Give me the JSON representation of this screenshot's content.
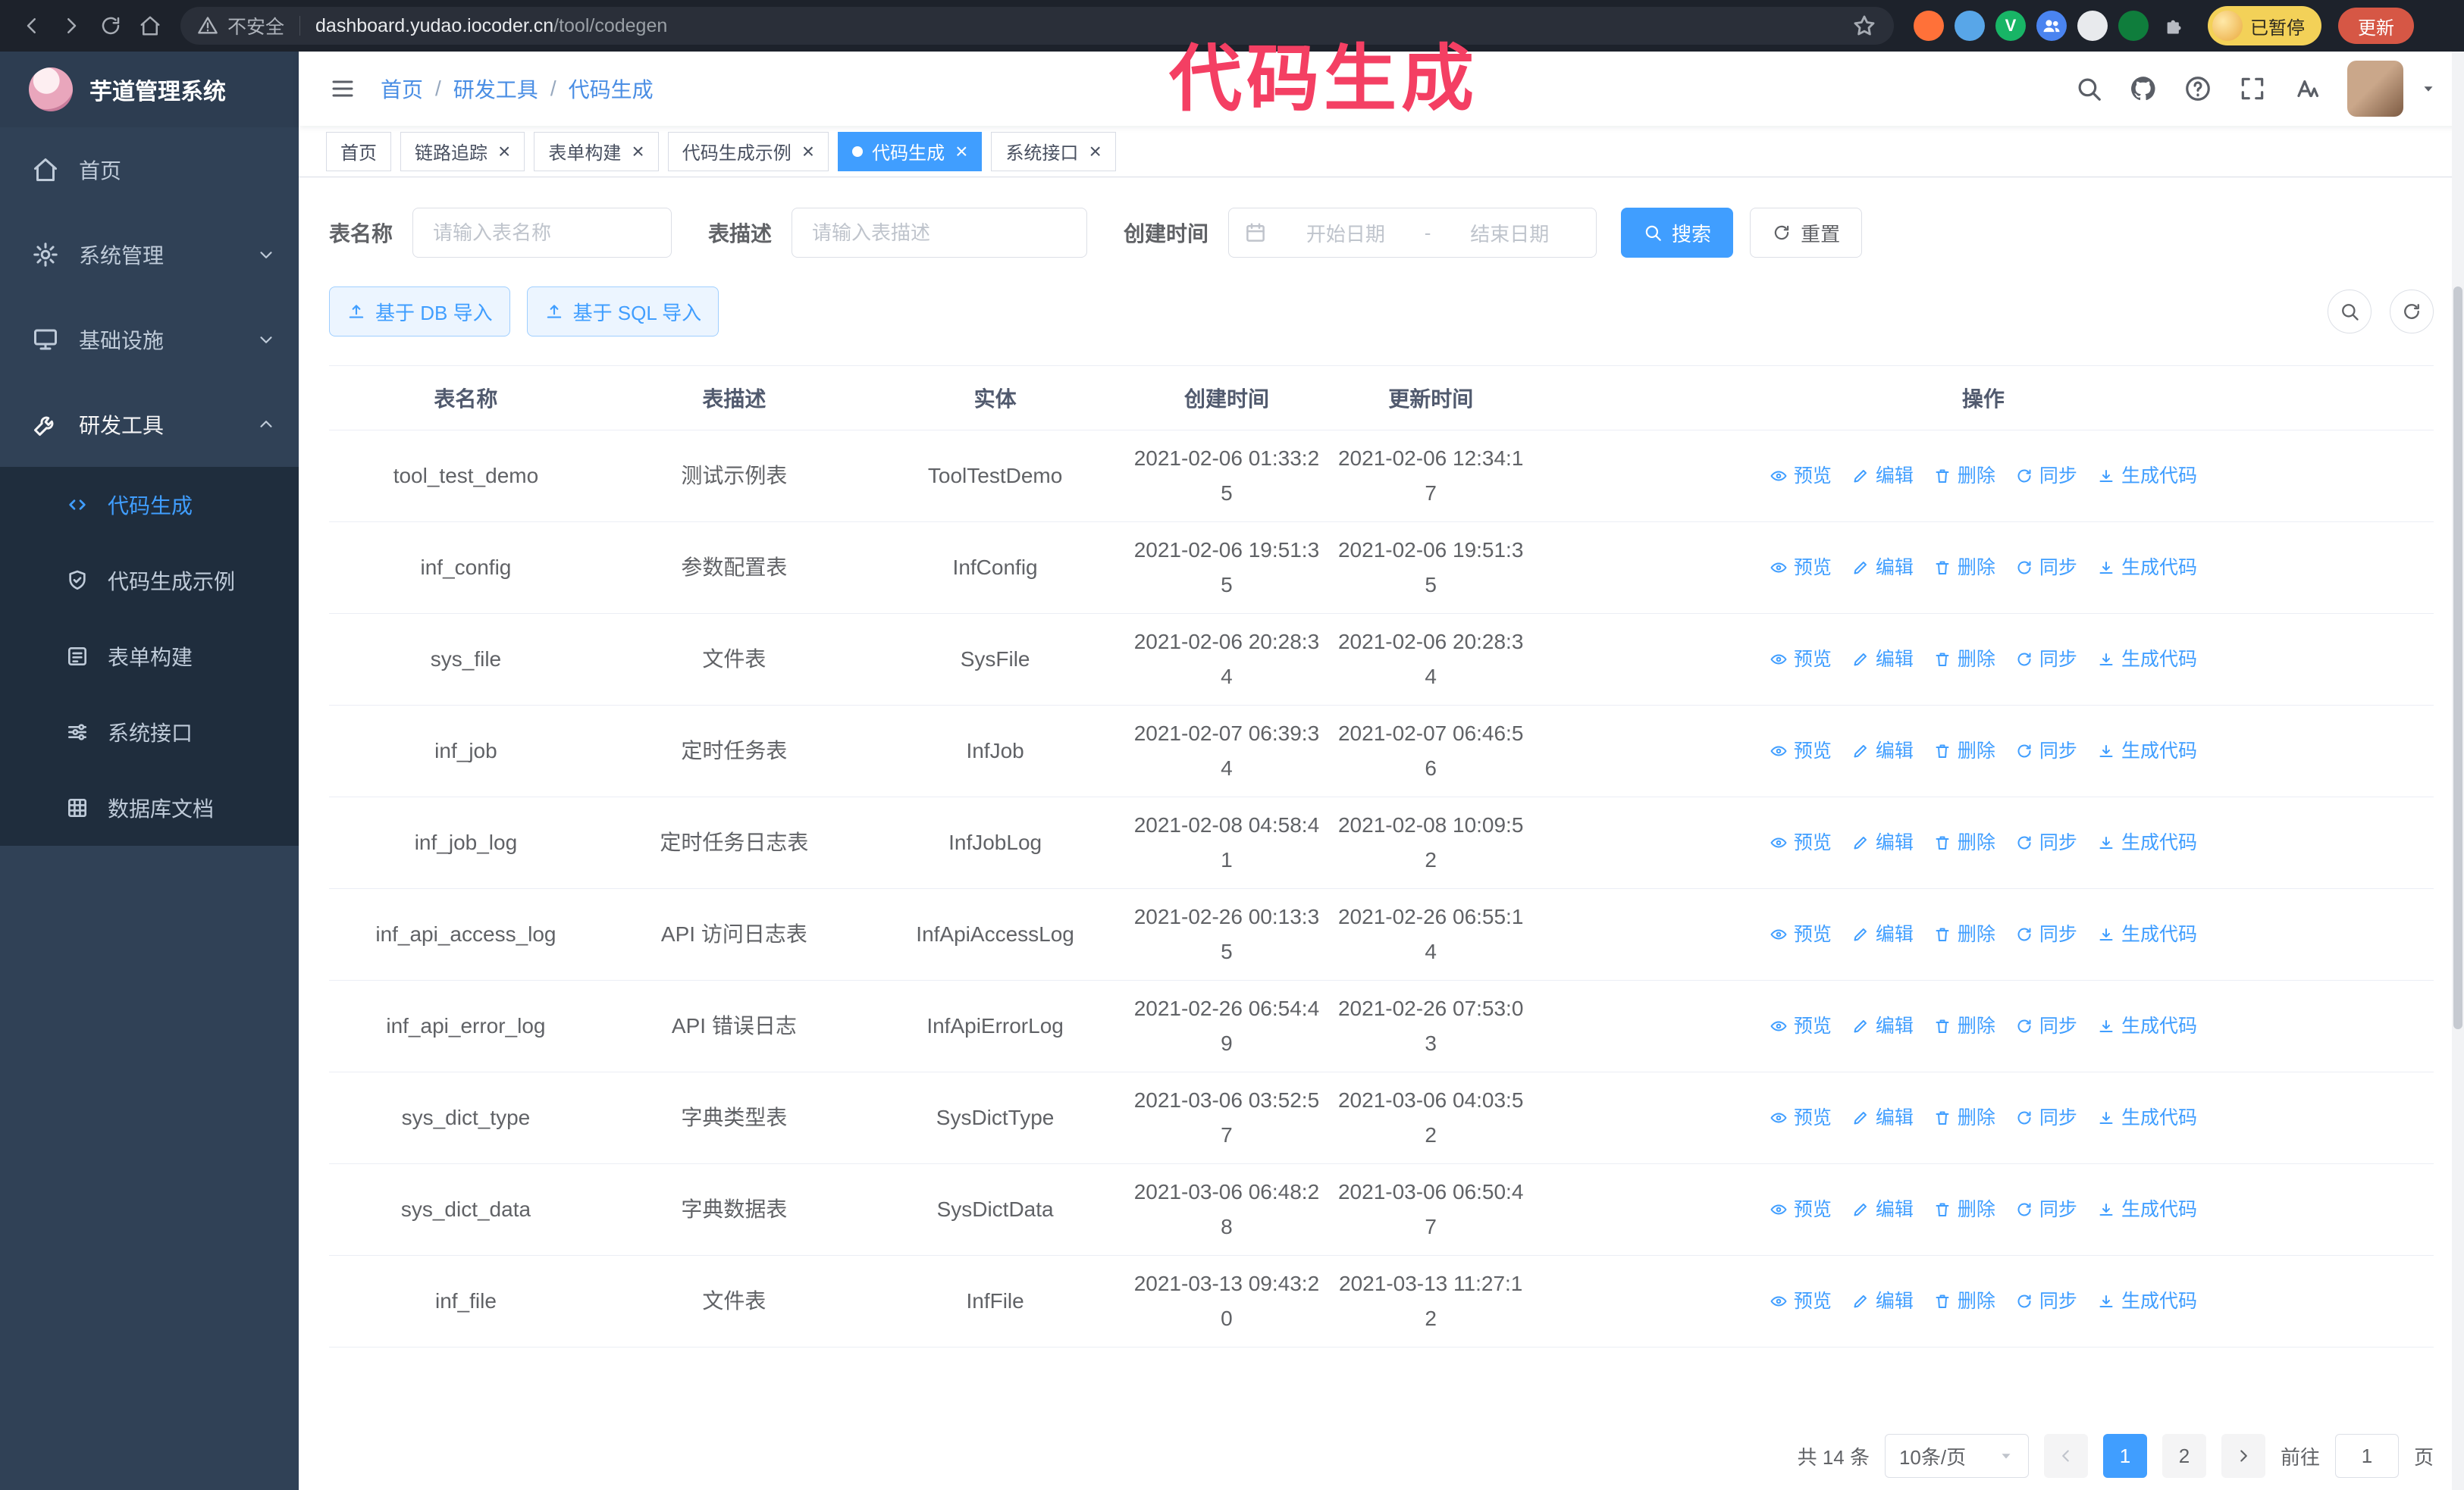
{
  "browser": {
    "security_label": "不安全",
    "url_host": "dashboard.yudao.iocoder.cn",
    "url_path": "/tool/codegen",
    "paused_label": "已暂停",
    "update_label": "更新",
    "extensions": [
      {
        "name": "extension-icon-orange",
        "color": "#ff7139",
        "glyph": ""
      },
      {
        "name": "extension-icon-blue-drop",
        "color": "#58a6e8",
        "glyph": ""
      },
      {
        "name": "extension-icon-green-check",
        "color": "#18b566",
        "glyph": "V"
      },
      {
        "name": "extension-icon-people",
        "color": "#4a84f0",
        "icon": "people-icon"
      },
      {
        "name": "extension-icon-light-tile",
        "color": "#e8eaed",
        "glyph": ""
      },
      {
        "name": "extension-icon-plant",
        "color": "#0f7d3c",
        "glyph": ""
      },
      {
        "name": "extensions-puzzle-icon",
        "color": "",
        "icon": "puzzle-icon"
      }
    ]
  },
  "annotation": "代码生成",
  "colors": {
    "accent": "#409eff",
    "sidebar_bg": "#304156",
    "submenu_bg": "#1f2d3d",
    "annotation": "#f43f63",
    "active_tab_bg": "#409eff"
  },
  "sidebar": {
    "title": "芋道管理系统",
    "menu": [
      {
        "id": "home",
        "label": "首页",
        "icon": "home-icon"
      },
      {
        "id": "system",
        "label": "系统管理",
        "icon": "gear-icon",
        "chevron": "down"
      },
      {
        "id": "infra",
        "label": "基础设施",
        "icon": "monitor-icon",
        "chevron": "down"
      },
      {
        "id": "devtools",
        "label": "研发工具",
        "icon": "tools-icon",
        "chevron": "up",
        "expanded": true,
        "children": [
          {
            "id": "codegen",
            "label": "代码生成",
            "icon": "code-icon",
            "active": true
          },
          {
            "id": "codegen-example",
            "label": "代码生成示例",
            "icon": "shield-icon"
          },
          {
            "id": "form-builder",
            "label": "表单构建",
            "icon": "form-icon"
          },
          {
            "id": "system-api",
            "label": "系统接口",
            "icon": "sliders-icon"
          },
          {
            "id": "db-doc",
            "label": "数据库文档",
            "icon": "grid-icon"
          }
        ]
      }
    ]
  },
  "header": {
    "breadcrumb": [
      "首页",
      "研发工具",
      "代码生成"
    ]
  },
  "tabs": [
    {
      "id": "home",
      "label": "首页",
      "closable": false,
      "active": false
    },
    {
      "id": "tracer",
      "label": "链路追踪",
      "closable": true,
      "active": false
    },
    {
      "id": "form-builder",
      "label": "表单构建",
      "closable": true,
      "active": false
    },
    {
      "id": "codegen-example",
      "label": "代码生成示例",
      "closable": true,
      "active": false
    },
    {
      "id": "codegen",
      "label": "代码生成",
      "closable": true,
      "active": true
    },
    {
      "id": "system-api",
      "label": "系统接口",
      "closable": true,
      "active": false
    }
  ],
  "filters": {
    "name_label": "表名称",
    "name_placeholder": "请输入表名称",
    "desc_label": "表描述",
    "desc_placeholder": "请输入表描述",
    "time_label": "创建时间",
    "start_placeholder": "开始日期",
    "range_separator": "-",
    "end_placeholder": "结束日期",
    "search_label": "搜索",
    "reset_label": "重置"
  },
  "toolbar": {
    "import_db_label": "基于 DB 导入",
    "import_sql_label": "基于 SQL 导入"
  },
  "table": {
    "columns": [
      "表名称",
      "表描述",
      "实体",
      "创建时间",
      "更新时间",
      "操作"
    ],
    "actions": [
      {
        "name": "preview-link",
        "label": "预览",
        "icon": "eye-icon"
      },
      {
        "name": "edit-link",
        "label": "编辑",
        "icon": "edit-icon"
      },
      {
        "name": "delete-link",
        "label": "删除",
        "icon": "delete-icon"
      },
      {
        "name": "sync-link",
        "label": "同步",
        "icon": "sync-icon"
      },
      {
        "name": "generate-code-link",
        "label": "生成代码",
        "icon": "download-icon"
      }
    ],
    "rows": [
      {
        "name": "tool_test_demo",
        "desc": "测试示例表",
        "entity": "ToolTestDemo",
        "created": "2021-02-06 01:33:25",
        "updated": "2021-02-06 12:34:17"
      },
      {
        "name": "inf_config",
        "desc": "参数配置表",
        "entity": "InfConfig",
        "created": "2021-02-06 19:51:35",
        "updated": "2021-02-06 19:51:35"
      },
      {
        "name": "sys_file",
        "desc": "文件表",
        "entity": "SysFile",
        "created": "2021-02-06 20:28:34",
        "updated": "2021-02-06 20:28:34"
      },
      {
        "name": "inf_job",
        "desc": "定时任务表",
        "entity": "InfJob",
        "created": "2021-02-07 06:39:34",
        "updated": "2021-02-07 06:46:56"
      },
      {
        "name": "inf_job_log",
        "desc": "定时任务日志表",
        "entity": "InfJobLog",
        "created": "2021-02-08 04:58:41",
        "updated": "2021-02-08 10:09:52"
      },
      {
        "name": "inf_api_access_log",
        "desc": "API 访问日志表",
        "entity": "InfApiAccessLog",
        "created": "2021-02-26 00:13:35",
        "updated": "2021-02-26 06:55:14"
      },
      {
        "name": "inf_api_error_log",
        "desc": "API 错误日志",
        "entity": "InfApiErrorLog",
        "created": "2021-02-26 06:54:49",
        "updated": "2021-02-26 07:53:03"
      },
      {
        "name": "sys_dict_type",
        "desc": "字典类型表",
        "entity": "SysDictType",
        "created": "2021-03-06 03:52:57",
        "updated": "2021-03-06 04:03:52"
      },
      {
        "name": "sys_dict_data",
        "desc": "字典数据表",
        "entity": "SysDictData",
        "created": "2021-03-06 06:48:28",
        "updated": "2021-03-06 06:50:47"
      },
      {
        "name": "inf_file",
        "desc": "文件表",
        "entity": "InfFile",
        "created": "2021-03-13 09:43:20",
        "updated": "2021-03-13 11:27:12"
      }
    ]
  },
  "pagination": {
    "total_label": "共 14 条",
    "page_size_label": "10条/页",
    "pages": [
      "1",
      "2"
    ],
    "active_page": "1",
    "goto_label": "前往",
    "goto_value": "1",
    "unit_label": "页"
  }
}
